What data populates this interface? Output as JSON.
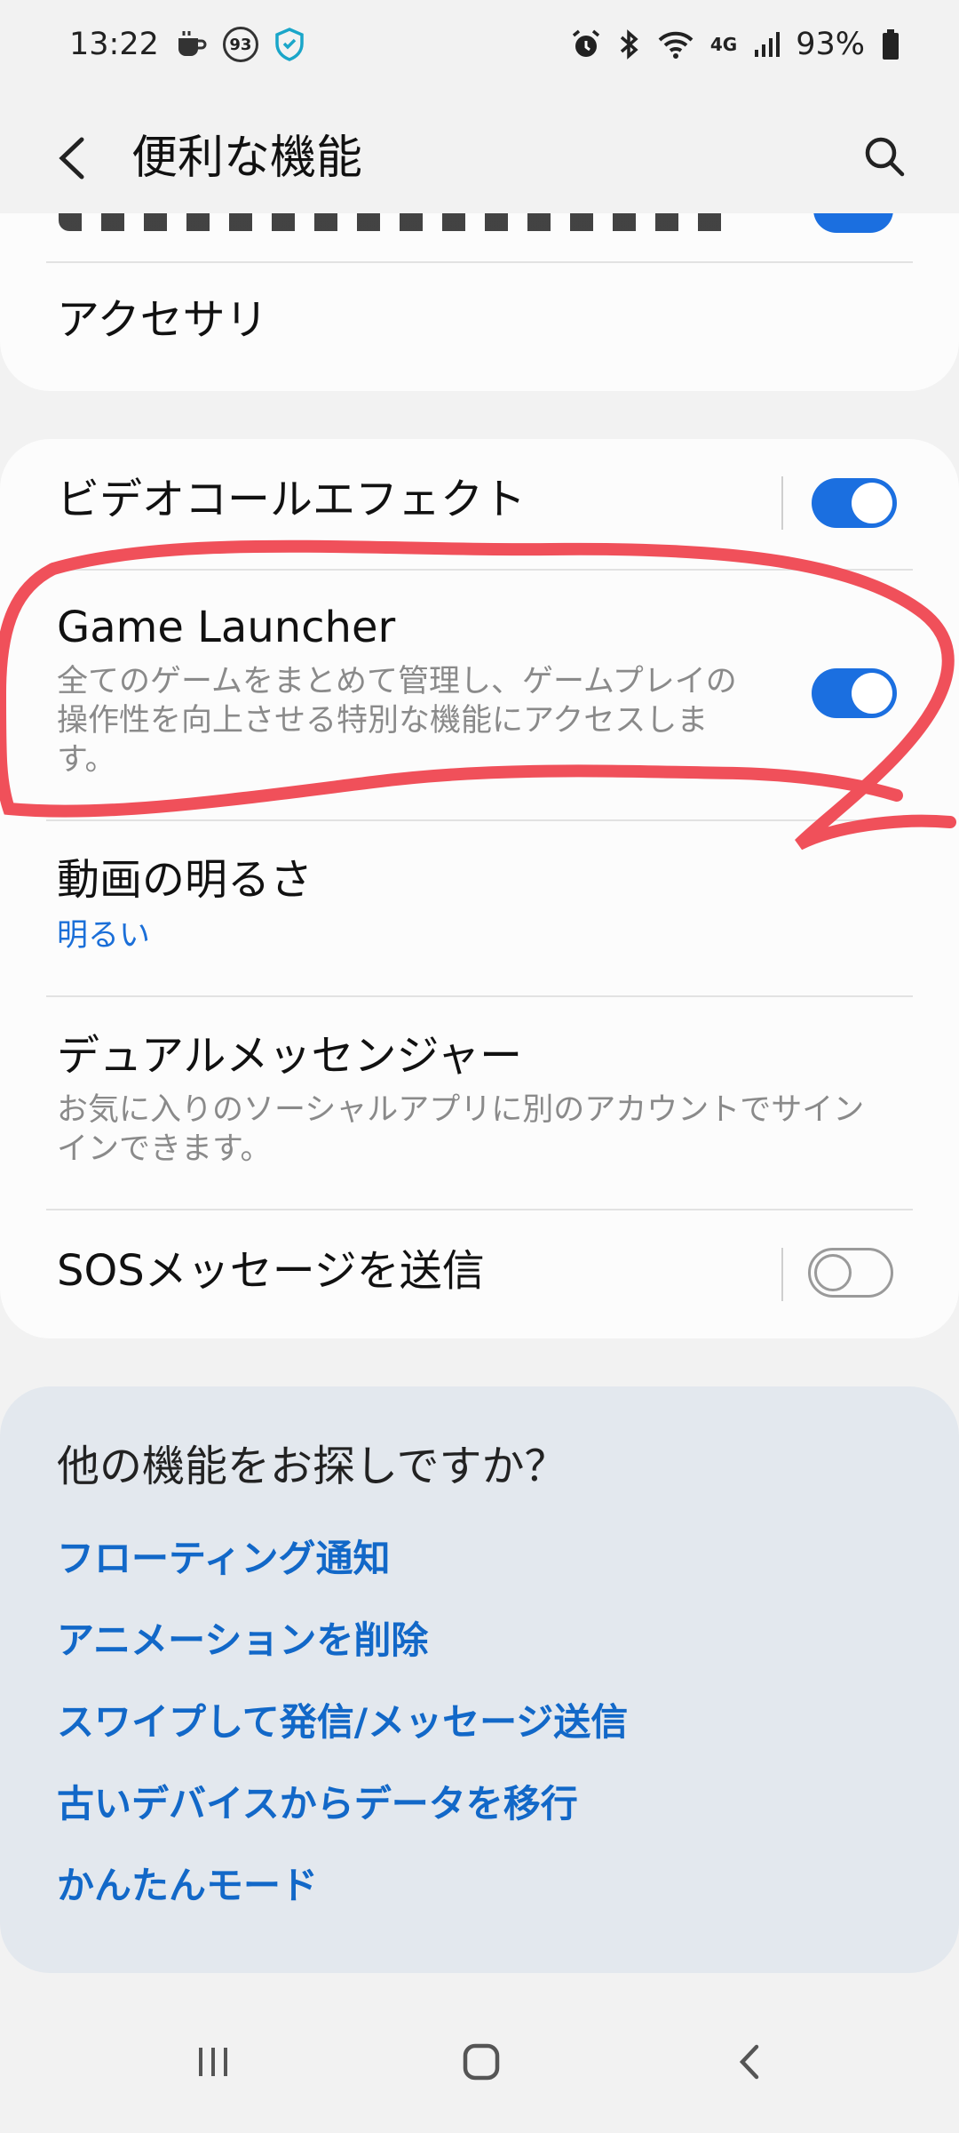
{
  "status": {
    "time": "13:22",
    "badge_number": "93",
    "network": "4G",
    "battery": "93%"
  },
  "header": {
    "title": "便利な機能"
  },
  "card1": {
    "accessory_label": "アクセサリ"
  },
  "settings": {
    "video_call_effect": {
      "title": "ビデオコールエフェクト",
      "toggle": "on"
    },
    "game_launcher": {
      "title": "Game Launcher",
      "desc_line1": "全てのゲームをまとめて管理し、ゲームプレイの",
      "desc_line2": "操作性を向上させる特別な機能にアクセスしま",
      "desc_line3": "す。",
      "toggle": "on"
    },
    "video_brightness": {
      "title": "動画の明るさ",
      "value": "明るい"
    },
    "dual_messenger": {
      "title": "デュアルメッセンジャー",
      "desc_line1": "お気に入りのソーシャルアプリに別のアカウントでサイン",
      "desc_line2": "インできます。"
    },
    "sos_message": {
      "title": "SOSメッセージを送信",
      "toggle": "off"
    }
  },
  "suggestions": {
    "title": "他の機能をお探しですか？",
    "links": [
      "フローティング通知",
      "アニメーションを削除",
      "スワイプして発信/メッセージ送信",
      "古いデバイスからデータを移行",
      "かんたんモード"
    ]
  },
  "colors": {
    "accent_blue": "#1b6fe0",
    "link_blue": "#1268c8",
    "annotation_red": "#f0505a",
    "card_bg": "#fcfcfc",
    "page_bg": "#f2f2f2",
    "suggestion_bg": "#e3e8ee"
  },
  "icons": {
    "back": "chevron-left-icon",
    "search": "search-icon",
    "alarm": "alarm-icon",
    "bluetooth": "bluetooth-icon",
    "wifi": "wifi-icon",
    "signal": "signal-icon",
    "battery": "battery-icon"
  }
}
